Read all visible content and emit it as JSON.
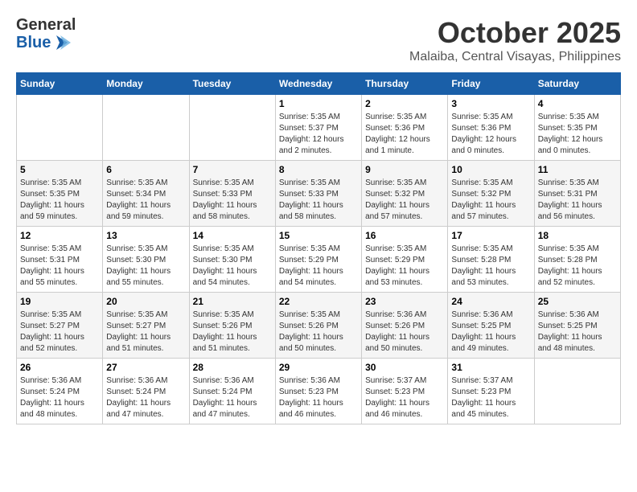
{
  "header": {
    "logo_general": "General",
    "logo_blue": "Blue",
    "month": "October 2025",
    "location": "Malaiba, Central Visayas, Philippines"
  },
  "weekdays": [
    "Sunday",
    "Monday",
    "Tuesday",
    "Wednesday",
    "Thursday",
    "Friday",
    "Saturday"
  ],
  "weeks": [
    [
      {
        "day": "",
        "info": ""
      },
      {
        "day": "",
        "info": ""
      },
      {
        "day": "",
        "info": ""
      },
      {
        "day": "1",
        "info": "Sunrise: 5:35 AM\nSunset: 5:37 PM\nDaylight: 12 hours\nand 2 minutes."
      },
      {
        "day": "2",
        "info": "Sunrise: 5:35 AM\nSunset: 5:36 PM\nDaylight: 12 hours\nand 1 minute."
      },
      {
        "day": "3",
        "info": "Sunrise: 5:35 AM\nSunset: 5:36 PM\nDaylight: 12 hours\nand 0 minutes."
      },
      {
        "day": "4",
        "info": "Sunrise: 5:35 AM\nSunset: 5:35 PM\nDaylight: 12 hours\nand 0 minutes."
      }
    ],
    [
      {
        "day": "5",
        "info": "Sunrise: 5:35 AM\nSunset: 5:35 PM\nDaylight: 11 hours\nand 59 minutes."
      },
      {
        "day": "6",
        "info": "Sunrise: 5:35 AM\nSunset: 5:34 PM\nDaylight: 11 hours\nand 59 minutes."
      },
      {
        "day": "7",
        "info": "Sunrise: 5:35 AM\nSunset: 5:33 PM\nDaylight: 11 hours\nand 58 minutes."
      },
      {
        "day": "8",
        "info": "Sunrise: 5:35 AM\nSunset: 5:33 PM\nDaylight: 11 hours\nand 58 minutes."
      },
      {
        "day": "9",
        "info": "Sunrise: 5:35 AM\nSunset: 5:32 PM\nDaylight: 11 hours\nand 57 minutes."
      },
      {
        "day": "10",
        "info": "Sunrise: 5:35 AM\nSunset: 5:32 PM\nDaylight: 11 hours\nand 57 minutes."
      },
      {
        "day": "11",
        "info": "Sunrise: 5:35 AM\nSunset: 5:31 PM\nDaylight: 11 hours\nand 56 minutes."
      }
    ],
    [
      {
        "day": "12",
        "info": "Sunrise: 5:35 AM\nSunset: 5:31 PM\nDaylight: 11 hours\nand 55 minutes."
      },
      {
        "day": "13",
        "info": "Sunrise: 5:35 AM\nSunset: 5:30 PM\nDaylight: 11 hours\nand 55 minutes."
      },
      {
        "day": "14",
        "info": "Sunrise: 5:35 AM\nSunset: 5:30 PM\nDaylight: 11 hours\nand 54 minutes."
      },
      {
        "day": "15",
        "info": "Sunrise: 5:35 AM\nSunset: 5:29 PM\nDaylight: 11 hours\nand 54 minutes."
      },
      {
        "day": "16",
        "info": "Sunrise: 5:35 AM\nSunset: 5:29 PM\nDaylight: 11 hours\nand 53 minutes."
      },
      {
        "day": "17",
        "info": "Sunrise: 5:35 AM\nSunset: 5:28 PM\nDaylight: 11 hours\nand 53 minutes."
      },
      {
        "day": "18",
        "info": "Sunrise: 5:35 AM\nSunset: 5:28 PM\nDaylight: 11 hours\nand 52 minutes."
      }
    ],
    [
      {
        "day": "19",
        "info": "Sunrise: 5:35 AM\nSunset: 5:27 PM\nDaylight: 11 hours\nand 52 minutes."
      },
      {
        "day": "20",
        "info": "Sunrise: 5:35 AM\nSunset: 5:27 PM\nDaylight: 11 hours\nand 51 minutes."
      },
      {
        "day": "21",
        "info": "Sunrise: 5:35 AM\nSunset: 5:26 PM\nDaylight: 11 hours\nand 51 minutes."
      },
      {
        "day": "22",
        "info": "Sunrise: 5:35 AM\nSunset: 5:26 PM\nDaylight: 11 hours\nand 50 minutes."
      },
      {
        "day": "23",
        "info": "Sunrise: 5:36 AM\nSunset: 5:26 PM\nDaylight: 11 hours\nand 50 minutes."
      },
      {
        "day": "24",
        "info": "Sunrise: 5:36 AM\nSunset: 5:25 PM\nDaylight: 11 hours\nand 49 minutes."
      },
      {
        "day": "25",
        "info": "Sunrise: 5:36 AM\nSunset: 5:25 PM\nDaylight: 11 hours\nand 48 minutes."
      }
    ],
    [
      {
        "day": "26",
        "info": "Sunrise: 5:36 AM\nSunset: 5:24 PM\nDaylight: 11 hours\nand 48 minutes."
      },
      {
        "day": "27",
        "info": "Sunrise: 5:36 AM\nSunset: 5:24 PM\nDaylight: 11 hours\nand 47 minutes."
      },
      {
        "day": "28",
        "info": "Sunrise: 5:36 AM\nSunset: 5:24 PM\nDaylight: 11 hours\nand 47 minutes."
      },
      {
        "day": "29",
        "info": "Sunrise: 5:36 AM\nSunset: 5:23 PM\nDaylight: 11 hours\nand 46 minutes."
      },
      {
        "day": "30",
        "info": "Sunrise: 5:37 AM\nSunset: 5:23 PM\nDaylight: 11 hours\nand 46 minutes."
      },
      {
        "day": "31",
        "info": "Sunrise: 5:37 AM\nSunset: 5:23 PM\nDaylight: 11 hours\nand 45 minutes."
      },
      {
        "day": "",
        "info": ""
      }
    ]
  ]
}
